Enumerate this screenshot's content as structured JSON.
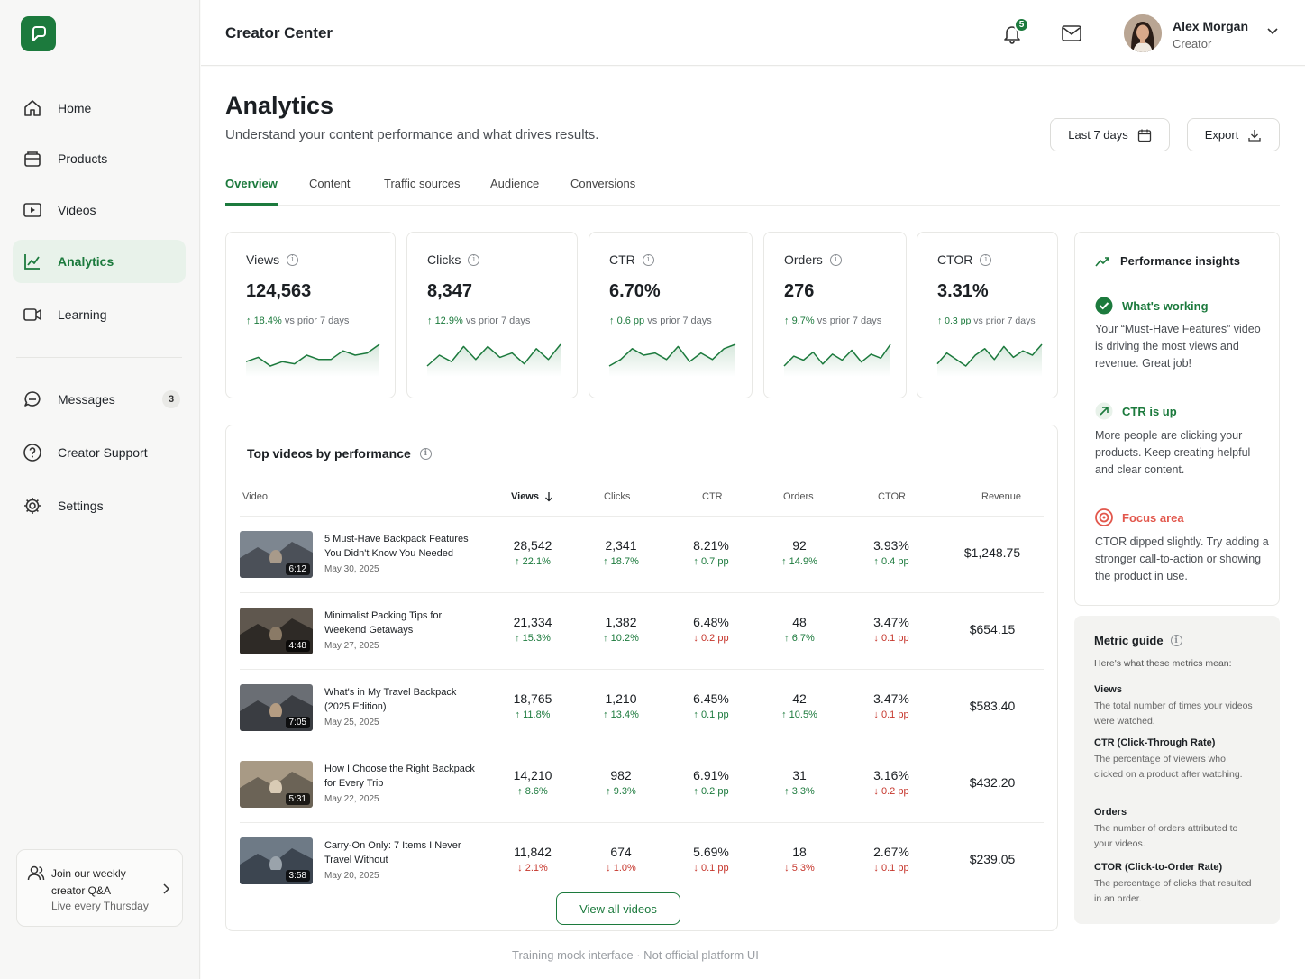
{
  "app": {
    "title": "Creator Center"
  },
  "user": {
    "name": "Alex Morgan",
    "role": "Creator",
    "notifications": "5"
  },
  "sidebar": {
    "items": [
      {
        "label": "Home",
        "icon": "home-icon"
      },
      {
        "label": "Products",
        "icon": "box-icon"
      },
      {
        "label": "Videos",
        "icon": "video-icon"
      },
      {
        "label": "Analytics",
        "icon": "chart-icon",
        "active": true
      },
      {
        "label": "Learning",
        "icon": "learning-icon"
      },
      {
        "label": "Messages",
        "icon": "chat-icon",
        "count": "3"
      },
      {
        "label": "Creator Support",
        "icon": "help-icon"
      },
      {
        "label": "Settings",
        "icon": "gear-icon"
      }
    ],
    "qa": {
      "line1": "Join our weekly creator Q&A",
      "line2": "Live every Thursday"
    }
  },
  "page": {
    "title": "Analytics",
    "subtitle": "Understand your content performance and what drives results.",
    "date_range": "Last 7 days",
    "export_label": "Export",
    "tabs": [
      "Overview",
      "Content",
      "Traffic sources",
      "Audience",
      "Conversions"
    ]
  },
  "metrics": [
    {
      "label": "Views",
      "value": "124,563",
      "delta": "18.4%",
      "suffix": "vs prior 7 days",
      "trend": [
        14,
        12,
        16,
        14,
        15,
        11,
        13,
        13,
        9,
        11,
        10,
        6
      ]
    },
    {
      "label": "Clicks",
      "value": "8,347",
      "delta": "12.9%",
      "suffix": "vs prior 7 days",
      "trend": [
        15,
        10,
        13,
        6,
        12,
        6,
        11,
        9,
        14,
        7,
        12,
        5
      ]
    },
    {
      "label": "CTR",
      "value": "6.70%",
      "delta": "0.6 pp",
      "suffix": "vs prior 7 days",
      "trend": [
        15,
        12,
        7,
        10,
        9,
        12,
        6,
        13,
        9,
        12,
        7,
        5
      ]
    },
    {
      "label": "Orders",
      "value": "276",
      "delta": "9.7%",
      "suffix": "vs prior 7 days",
      "trend": [
        15,
        10,
        12,
        8,
        14,
        9,
        12,
        7,
        13,
        9,
        11,
        4
      ]
    },
    {
      "label": "CTOR",
      "value": "3.31%",
      "delta": "0.3 pp",
      "suffix": "vs prior 7 days",
      "trend": [
        14,
        9,
        12,
        15,
        10,
        7,
        12,
        6,
        11,
        8,
        10,
        5
      ]
    }
  ],
  "top_videos": {
    "title": "Top videos by performance",
    "columns": [
      "Video",
      "Views",
      "Clicks",
      "CTR",
      "Orders",
      "CTOR",
      "Revenue"
    ],
    "rows": [
      {
        "title": "5 Must-Have Backpack Features You Didn't Know You Needed",
        "date": "May 30, 2025",
        "duration": "6:12",
        "views": "28,542",
        "views_d": "22.1%",
        "clicks": "2,341",
        "clicks_d": "18.7%",
        "ctr": "8.21%",
        "ctr_d": "0.7 pp",
        "orders": "92",
        "orders_d": "14.9%",
        "ctor": "3.93%",
        "ctor_d": "0.4 pp",
        "revenue": "$1,248.75",
        "dirs": [
          "up",
          "up",
          "up",
          "up",
          "up"
        ]
      },
      {
        "title": "Minimalist Packing Tips for Weekend Getaways",
        "date": "May 27, 2025",
        "duration": "4:48",
        "views": "21,334",
        "views_d": "15.3%",
        "clicks": "1,382",
        "clicks_d": "10.2%",
        "ctr": "6.48%",
        "ctr_d": "0.2 pp",
        "orders": "48",
        "orders_d": "6.7%",
        "ctor": "3.47%",
        "ctor_d": "0.1 pp",
        "revenue": "$654.15",
        "dirs": [
          "up",
          "up",
          "down",
          "up",
          "down"
        ]
      },
      {
        "title": "What's in My Travel Backpack (2025 Edition)",
        "date": "May 25, 2025",
        "duration": "7:05",
        "views": "18,765",
        "views_d": "11.8%",
        "clicks": "1,210",
        "clicks_d": "13.4%",
        "ctr": "6.45%",
        "ctr_d": "0.1 pp",
        "orders": "42",
        "orders_d": "10.5%",
        "ctor": "3.47%",
        "ctor_d": "0.1 pp",
        "revenue": "$583.40",
        "dirs": [
          "up",
          "up",
          "up",
          "up",
          "down"
        ]
      },
      {
        "title": "How I Choose the Right Backpack for Every Trip",
        "date": "May 22, 2025",
        "duration": "5:31",
        "views": "14,210",
        "views_d": "8.6%",
        "clicks": "982",
        "clicks_d": "9.3%",
        "ctr": "6.91%",
        "ctr_d": "0.2 pp",
        "orders": "31",
        "orders_d": "3.3%",
        "ctor": "3.16%",
        "ctor_d": "0.2 pp",
        "revenue": "$432.20",
        "dirs": [
          "up",
          "up",
          "up",
          "up",
          "down"
        ]
      },
      {
        "title": "Carry-On Only: 7 Items I Never Travel Without",
        "date": "May 20, 2025",
        "duration": "3:58",
        "views": "11,842",
        "views_d": "2.1%",
        "clicks": "674",
        "clicks_d": "1.0%",
        "ctr": "5.69%",
        "ctr_d": "0.1 pp",
        "orders": "18",
        "orders_d": "5.3%",
        "ctor": "2.67%",
        "ctor_d": "0.1 pp",
        "revenue": "$239.05",
        "dirs": [
          "down",
          "down",
          "down",
          "down",
          "down"
        ]
      }
    ],
    "view_all": "View all videos"
  },
  "insights": {
    "title": "Performance insights",
    "working_title": "What's working",
    "working_text": "Your “Must-Have Features” video is driving the most views and revenue. Great job!",
    "ctr_title": "CTR is up",
    "ctr_text": "More people are clicking your products. Keep creating helpful and clear content.",
    "focus_title": "Focus area",
    "focus_text": "CTOR dipped slightly. Try adding a stronger call-to-action or showing the product in use."
  },
  "guide": {
    "title": "Metric guide",
    "intro": "Here's what these metrics mean:",
    "terms": [
      {
        "term": "Views",
        "def": "The total number of times your videos were watched."
      },
      {
        "term": "CTR (Click-Through Rate)",
        "def": "The percentage of viewers who clicked on a product after watching."
      },
      {
        "term": "Orders",
        "def": "The number of orders attributed to your videos."
      },
      {
        "term": "CTOR (Click-to-Order Rate)",
        "def": "The percentage of clicks that resulted in an order."
      }
    ]
  },
  "footer": "Training mock interface · Not official platform UI",
  "colors": {
    "accent": "#1c7a3d",
    "down": "#c6362c",
    "focus": "#e2574c"
  }
}
